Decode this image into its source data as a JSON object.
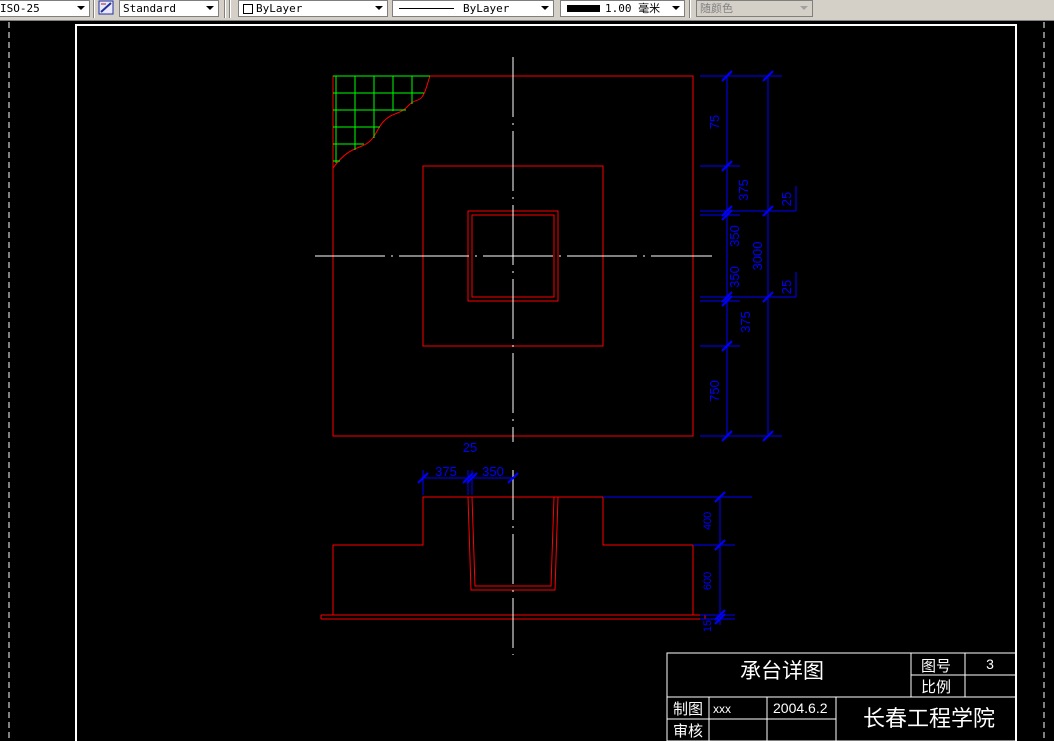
{
  "toolbar": {
    "text_style_value": "ISO-25",
    "dim_style_value": "Standard",
    "layer_color_value": "ByLayer",
    "linetype_value": "ByLayer",
    "lineweight_value": "1.00 毫米",
    "plot_style_value": "随颜色"
  },
  "plan_dims": {
    "d75": "75",
    "d375_top": "375",
    "d350_top": "350",
    "d350_bottom": "350",
    "d375_bottom": "375",
    "d750": "750",
    "d3000": "3000",
    "d25_top": "25",
    "d25_bottom": "25"
  },
  "section_dims": {
    "d25": "25",
    "d375": "375",
    "d350": "350",
    "d400": "400",
    "d600": "600",
    "d15": "15"
  },
  "title_block": {
    "title": "承台详图",
    "drawing_no_label": "图号",
    "drawing_no_value": "3",
    "scale_label": "比例",
    "drawn_by_label": "制图",
    "drawn_by_value": "xxx",
    "date": "2004.6.2",
    "reviewed_label": "审核",
    "institution": "长春工程学院"
  },
  "colors": {
    "red_geometry": "#ff0000",
    "dimension_blue": "#0000ff",
    "hatch_green": "#00ff00",
    "centerline_white": "#ffffff",
    "background": "#000000"
  }
}
